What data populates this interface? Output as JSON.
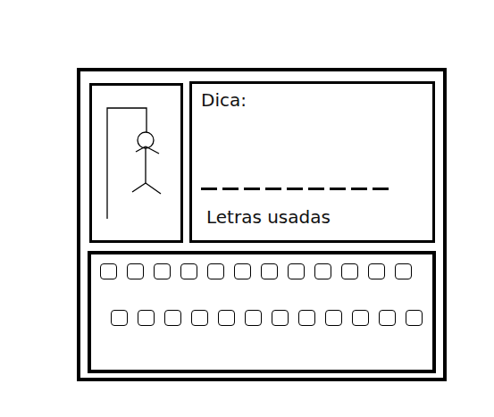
{
  "hangman": {
    "errors": 6
  },
  "hint": {
    "label": "Dica:"
  },
  "word": [
    {
      "letter": ""
    },
    {
      "letter": ""
    },
    {
      "letter": ""
    },
    {
      "letter": ""
    },
    {
      "letter": ""
    },
    {
      "letter": ""
    },
    {
      "letter": ""
    },
    {
      "letter": ""
    },
    {
      "letter": ""
    }
  ],
  "used_letters": {
    "label": "Letras usadas"
  },
  "keyboard": {
    "rows": [
      [
        {
          "label": ""
        },
        {
          "label": ""
        },
        {
          "label": ""
        },
        {
          "label": ""
        },
        {
          "label": ""
        },
        {
          "label": ""
        },
        {
          "label": ""
        },
        {
          "label": ""
        },
        {
          "label": ""
        },
        {
          "label": ""
        },
        {
          "label": ""
        },
        {
          "label": ""
        }
      ],
      [
        {
          "label": ""
        },
        {
          "label": ""
        },
        {
          "label": ""
        },
        {
          "label": ""
        },
        {
          "label": ""
        },
        {
          "label": ""
        },
        {
          "label": ""
        },
        {
          "label": ""
        },
        {
          "label": ""
        },
        {
          "label": ""
        },
        {
          "label": ""
        },
        {
          "label": ""
        }
      ]
    ]
  }
}
